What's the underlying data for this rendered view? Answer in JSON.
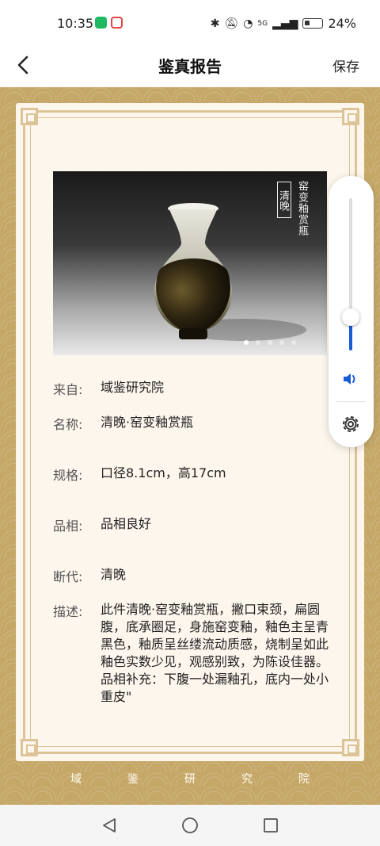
{
  "status_bar": {
    "time": "10:35",
    "network": "5G",
    "battery": "24%"
  },
  "nav": {
    "title": "鉴真报告",
    "save_label": "保存"
  },
  "photo": {
    "seal_text": "清晚",
    "caption": "窑变釉赏瓶",
    "slide_count": 5,
    "active_slide": 1
  },
  "info": {
    "source_label": "来自:",
    "source_value": "域鉴研究院",
    "name_label": "名称:",
    "name_value": "清晚·窑变釉赏瓶",
    "spec_label": "规格:",
    "spec_value": "口径8.1cm，高17cm",
    "condition_label": "品相:",
    "condition_value": "品相良好",
    "dating_label": "断代:",
    "dating_value": "清晚",
    "desc_label": "描述:",
    "desc_value": "此件清晚·窑变釉赏瓶，撇口束颈，扁圆腹，底承圈足，身施窑变釉，釉色主呈青黑色，釉质呈丝缕流动质感，烧制呈如此釉色实数少见，观感别致，为陈设佳器。",
    "desc_extra": "品相补充：下腹一处漏釉孔，底内一处小重皮\""
  },
  "footer": {
    "chars": [
      "域",
      "鉴",
      "研",
      "究",
      "院"
    ]
  },
  "volume": {
    "level": 0.22
  },
  "colors": {
    "gold": "#c5a868",
    "paper": "#fcf6ed",
    "frame": "#dcc498",
    "accent": "#1a5bd6"
  }
}
